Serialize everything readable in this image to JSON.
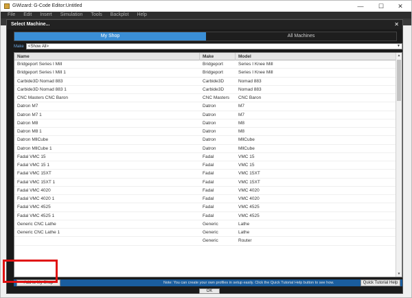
{
  "window": {
    "title": "GWizard: G-Code Editor:Untitled",
    "minimize": "—",
    "maximize": "☐",
    "close": "✕"
  },
  "menu": [
    "File",
    "Edit",
    "Insert",
    "Simulation",
    "Tools",
    "Backplot",
    "Help"
  ],
  "dialog": {
    "title": "Select Machine...",
    "close": "✕",
    "tabs": [
      "My Shop",
      "All Machines"
    ],
    "filter": {
      "label": "Make",
      "value": "<Show All>"
    },
    "columns": [
      "Name",
      "Make",
      "Model"
    ],
    "rows": [
      [
        "Bridgeport Series I Mill",
        "Bridgeport",
        "Series I Knee Mill"
      ],
      [
        "Bridgeport Series I Mill 1",
        "Bridgeport",
        "Series I Knee Mill"
      ],
      [
        "Carbide3D Nomad 883",
        "Carbide3D",
        "Nomad 883"
      ],
      [
        "Carbide3D Nomad 883 1",
        "Carbide3D",
        "Nomad 883"
      ],
      [
        "CNC Masters CNC Baron",
        "CNC Masters",
        "CNC Baron"
      ],
      [
        "Datron M7",
        "Datron",
        "M7"
      ],
      [
        "Datron M7 1",
        "Datron",
        "M7"
      ],
      [
        "Datron M8",
        "Datron",
        "M8"
      ],
      [
        "Datron M8 1",
        "Datron",
        "M8"
      ],
      [
        "Datron MllCube",
        "Datron",
        "MllCube"
      ],
      [
        "Datron MllCube 1",
        "Datron",
        "MllCube"
      ],
      [
        "Fadal VMC 15",
        "Fadal",
        "VMC 15"
      ],
      [
        "Fadal VMC 15 1",
        "Fadal",
        "VMC 15"
      ],
      [
        "Fadal VMC 15XT",
        "Fadal",
        "VMC 15XT"
      ],
      [
        "Fadal VMC 15XT 1",
        "Fadal",
        "VMC 15XT"
      ],
      [
        "Fadal VMC 4020",
        "Fadal",
        "VMC 4020"
      ],
      [
        "Fadal VMC 4020 1",
        "Fadal",
        "VMC 4020"
      ],
      [
        "Fadal VMC 4525",
        "Fadal",
        "VMC 4525"
      ],
      [
        "Fadal VMC 4525 1",
        "Fadal",
        "VMC 4525"
      ],
      [
        "Generic CNC Lathe",
        "Generic",
        "Lathe"
      ],
      [
        "Generic CNC Lathe 1",
        "Generic",
        "Lathe"
      ],
      [
        "",
        "Generic",
        "Router"
      ]
    ],
    "add_button": "Add to My Shop",
    "note": "Note: You can create your own profiles in setup easily. Click the Quick Tutorial Help button to see how.",
    "help_button": "Quick Tutorial Help",
    "ok_button": "OK"
  },
  "colors": {
    "accent": "#3a8ed6",
    "dialog_bg": "#1a1a1a",
    "highlight": "#e01010",
    "bottom_bar": "#1a5d9e"
  }
}
